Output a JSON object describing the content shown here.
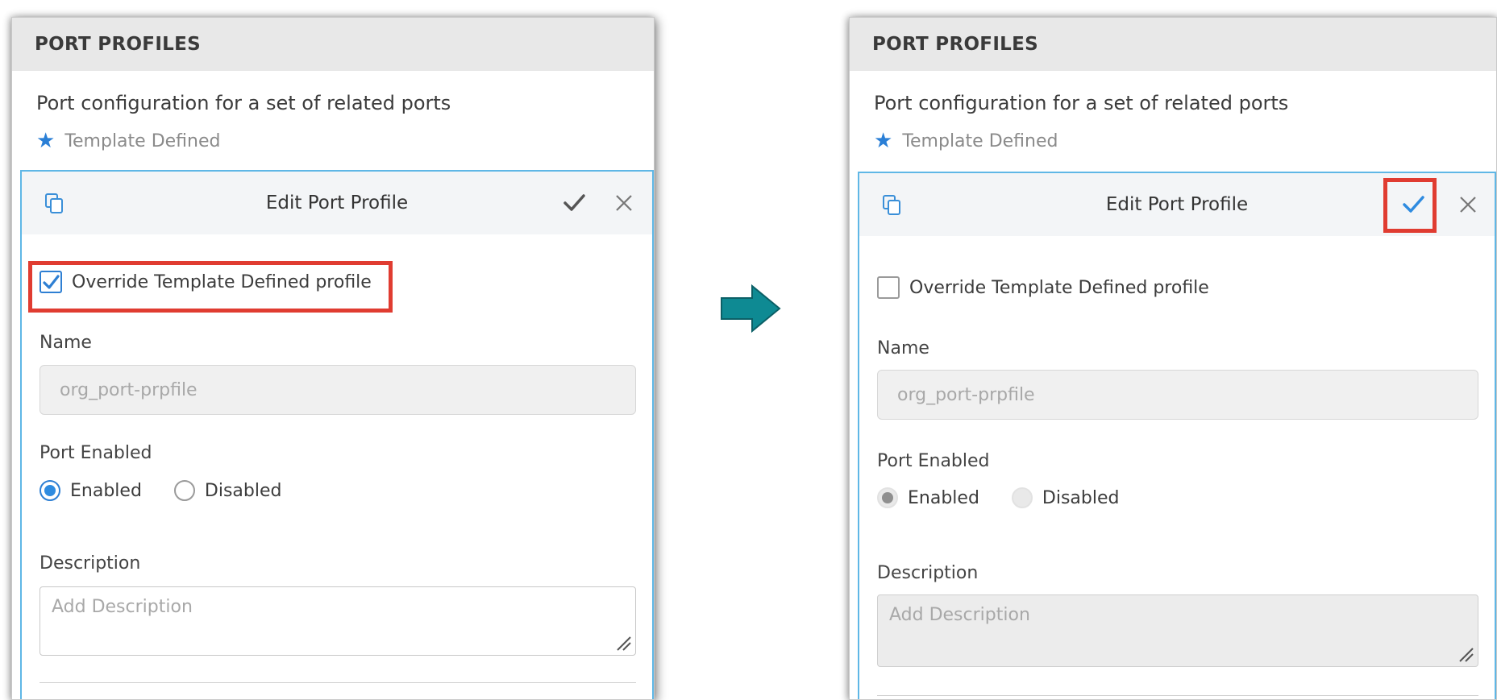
{
  "left_panel": {
    "header": "PORT PROFILES",
    "description": "Port configuration for a set of related ports",
    "note": "Template Defined",
    "edit": {
      "title": "Edit Port Profile",
      "override_label": "Override Template Defined profile",
      "override_checked": true,
      "name_label": "Name",
      "name_value": "org_port-prpfile",
      "port_enabled_label": "Port Enabled",
      "enabled_label": "Enabled",
      "disabled_label": "Disabled",
      "description_label": "Description",
      "description_placeholder": "Add Description"
    }
  },
  "right_panel": {
    "header": "PORT PROFILES",
    "description": "Port configuration for a set of related ports",
    "note": "Template Defined",
    "edit": {
      "title": "Edit Port Profile",
      "override_label": "Override Template Defined profile",
      "override_checked": false,
      "name_label": "Name",
      "name_value": "org_port-prpfile",
      "port_enabled_label": "Port Enabled",
      "enabled_label": "Enabled",
      "disabled_label": "Disabled",
      "description_label": "Description",
      "description_placeholder": "Add Description"
    }
  },
  "icons": {
    "copy": "copy-icon",
    "confirm": "checkmark-icon",
    "close": "close-icon",
    "note": "asterisk-icon",
    "transition": "arrow-right-icon"
  },
  "colors": {
    "accent": "#2e8be0",
    "highlight": "#e03c31",
    "card_border": "#5fb7e6",
    "arrow": "#0e8a93"
  }
}
